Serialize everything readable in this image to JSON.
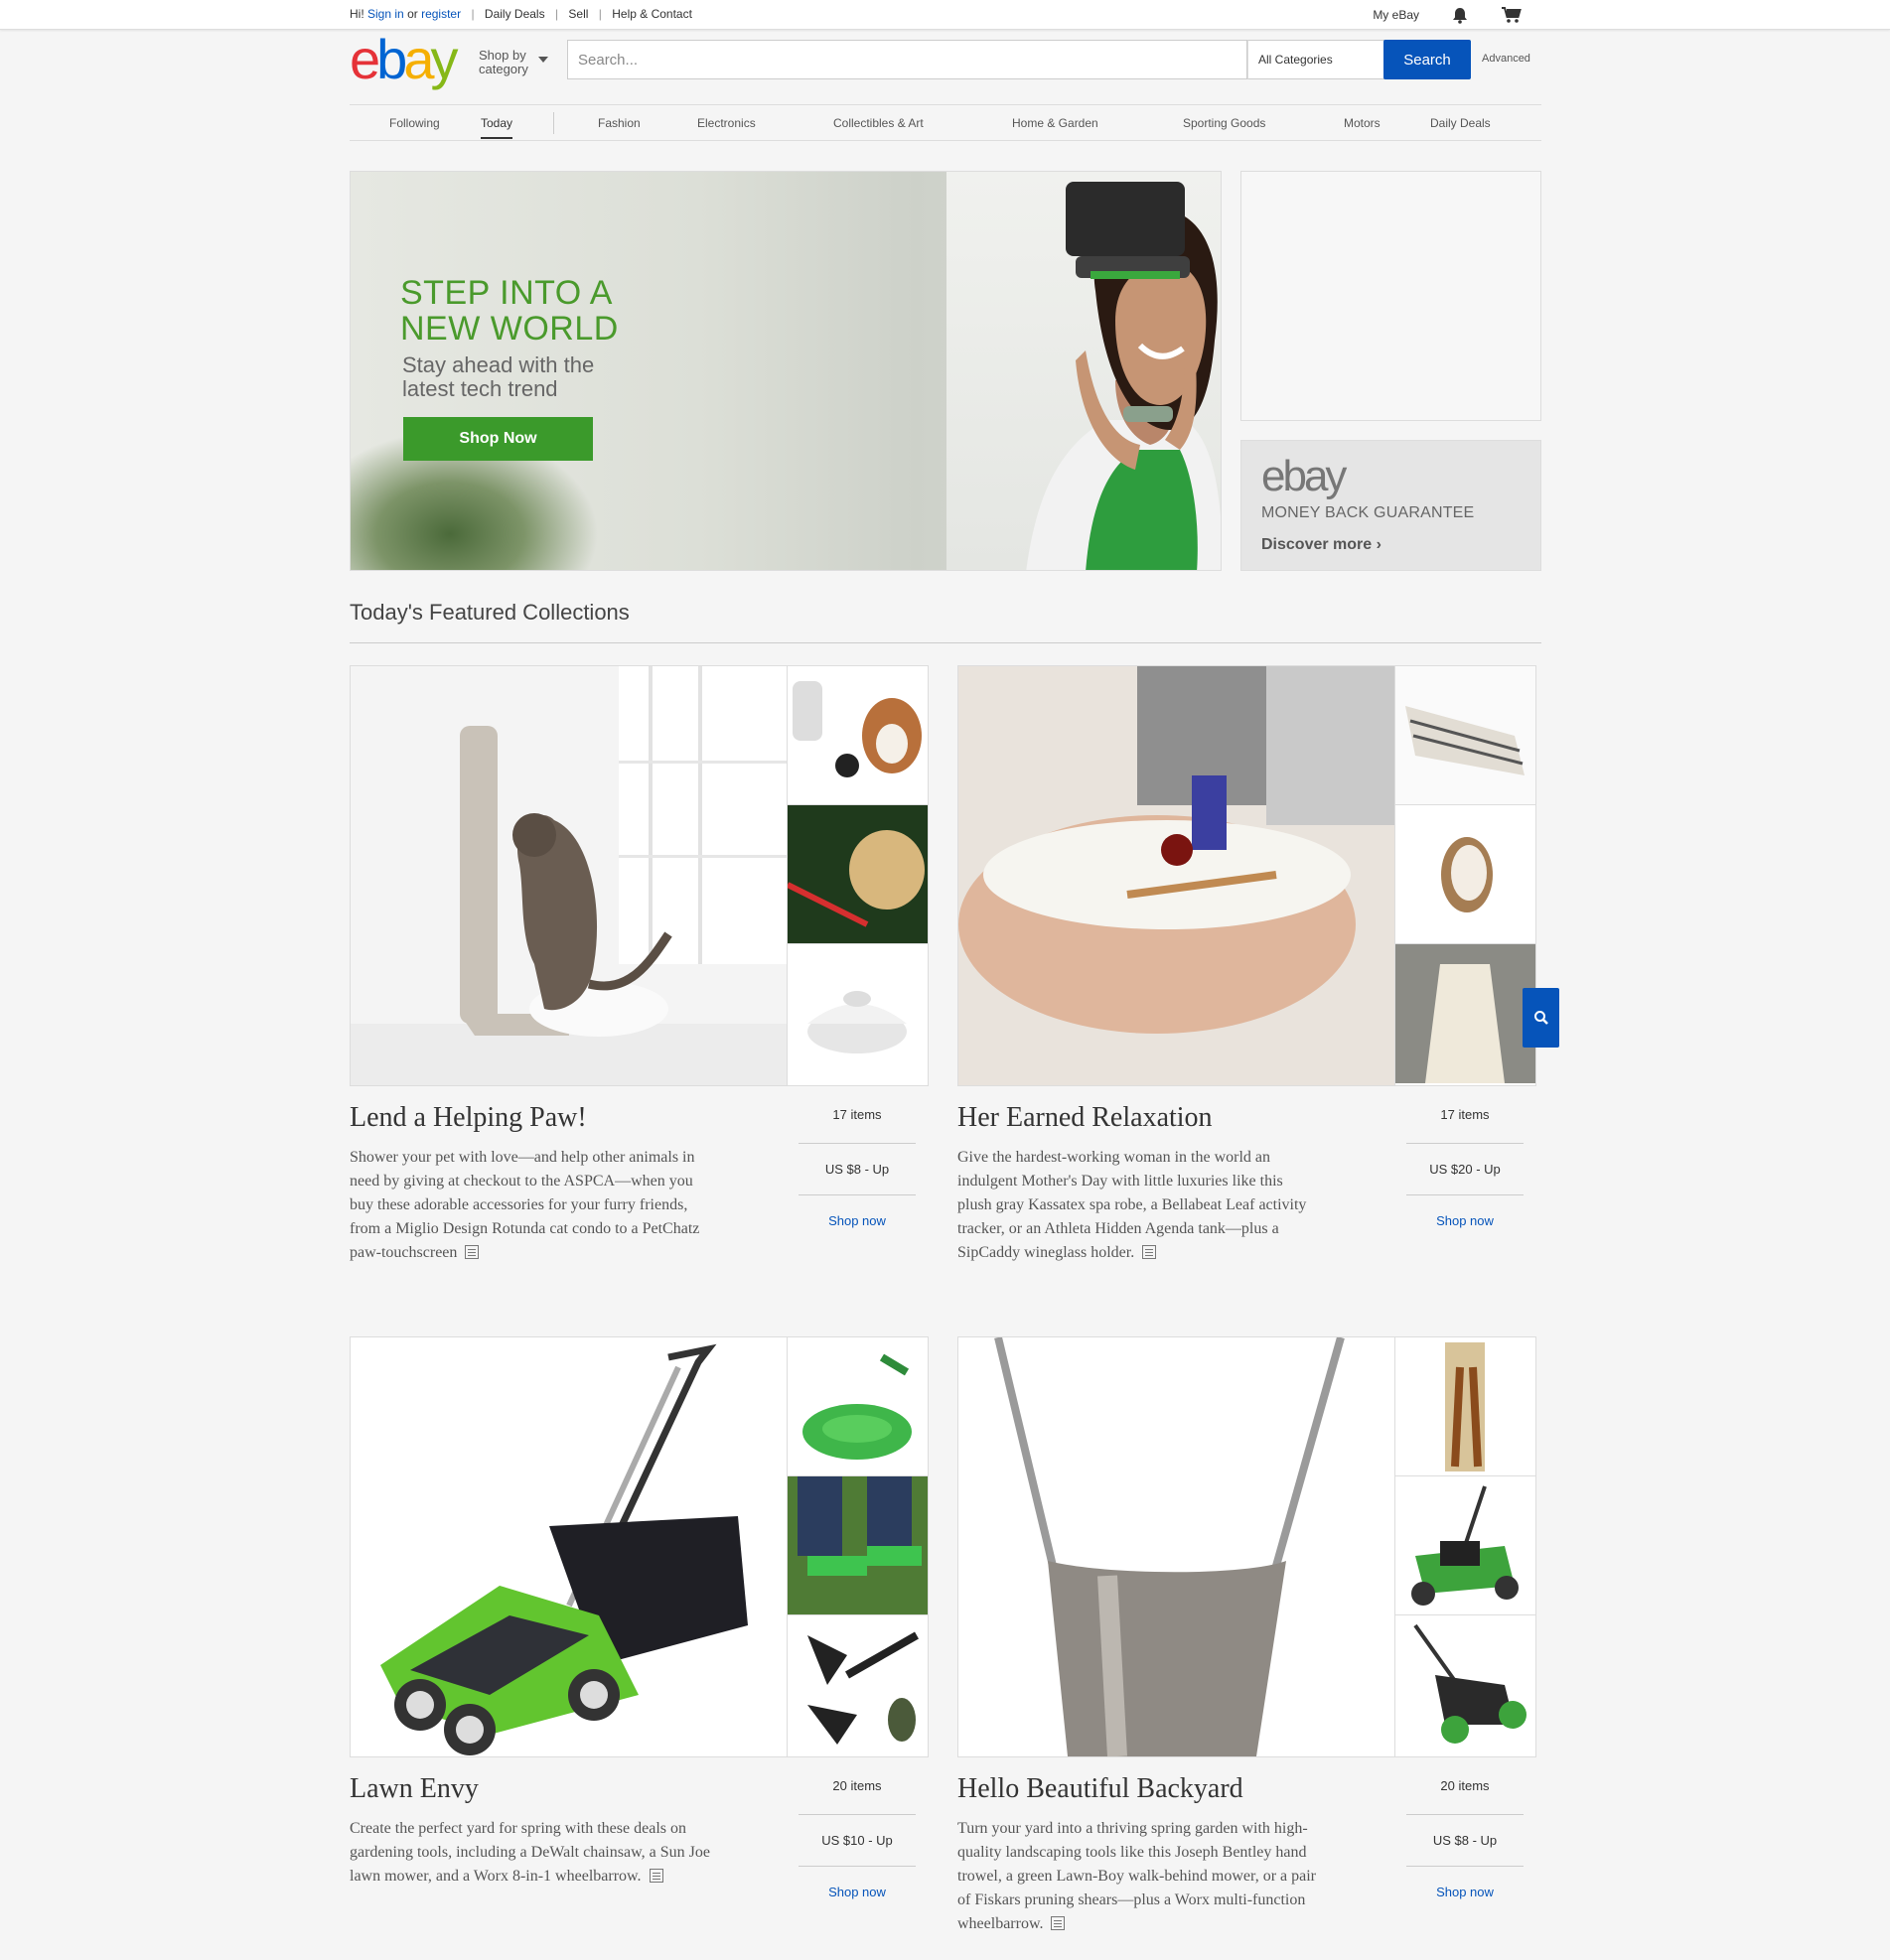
{
  "topbar": {
    "greeting": "Hi!",
    "sign_in": "Sign in",
    "or": "or",
    "register": "register",
    "links": [
      "Daily Deals",
      "Sell",
      "Help & Contact"
    ],
    "my_ebay": "My eBay"
  },
  "header": {
    "logo": [
      "e",
      "b",
      "a",
      "y"
    ],
    "shop_by": "Shop by",
    "category": "category",
    "search_placeholder": "Search...",
    "category_select": "All Categories",
    "search_button": "Search",
    "advanced": "Advanced"
  },
  "nav": {
    "items": [
      "Following",
      "Today",
      "Fashion",
      "Electronics",
      "Collectibles & Art",
      "Home & Garden",
      "Sporting Goods",
      "Motors",
      "Daily Deals"
    ],
    "active": "Today"
  },
  "hero": {
    "headline": "STEP INTO A\nNEW WORLD",
    "subline": "Stay ahead with the\nlatest tech trend",
    "cta": "Shop Now"
  },
  "money_back": {
    "logo": "ebay",
    "title": "MONEY BACK GUARANTEE",
    "link": "Discover more ›"
  },
  "featured": {
    "heading": "Today's Featured Collections",
    "collections": [
      {
        "title": "Lend a Helping Paw!",
        "desc": "Shower your pet with love—and help other animals in need by giving at checkout to the ASPCA—when you buy these adorable accessories for your furry friends, from a Miglio Design Rotunda cat condo to a PetChatz paw-touchscreen",
        "items": "17 items",
        "price": "US $8 - Up",
        "shop": "Shop now"
      },
      {
        "title": "Her Earned Relaxation",
        "desc": "Give the hardest-working woman in the world an indulgent Mother's Day with little luxuries like this plush gray Kassatex spa robe, a Bellabeat Leaf activity tracker, or an Athleta Hidden Agenda tank—plus a SipCaddy wineglass holder.",
        "items": "17 items",
        "price": "US $20 - Up",
        "shop": "Shop now"
      },
      {
        "title": "Lawn Envy",
        "desc": "Create the perfect yard for spring with these deals on gardening tools, including a DeWalt chainsaw, a Sun Joe lawn mower, and a Worx 8-in-1 wheelbarrow.",
        "items": "20 items",
        "price": "US $10 - Up",
        "shop": "Shop now"
      },
      {
        "title": "Hello Beautiful Backyard",
        "desc": "Turn your yard into a thriving spring garden with high-quality landscaping tools like this Joseph Bentley hand trowel, a green Lawn-Boy walk-behind mower, or a pair of Fiskars pruning shears—plus a Worx multi-function wheelbarrow.",
        "items": "20 items",
        "price": "US $8 - Up",
        "shop": "Shop now"
      }
    ]
  },
  "icons": {
    "bell": "bell-icon",
    "cart": "cart-icon",
    "search": "search-icon",
    "doc": "document-icon"
  },
  "colors": {
    "link": "#0654ba",
    "brand_red": "#e53238",
    "brand_blue": "#0064d2",
    "brand_yellow": "#f5af02",
    "brand_green": "#86b817",
    "hero_green": "#3b9a2b"
  }
}
